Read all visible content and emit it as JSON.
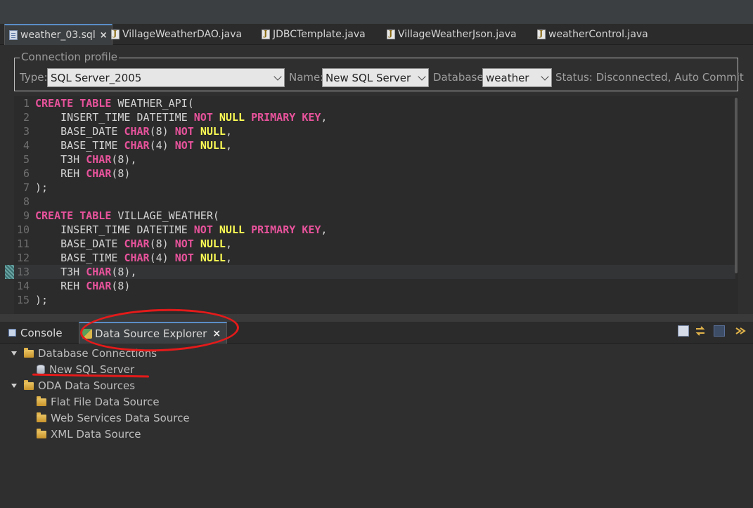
{
  "editor_tabs": [
    {
      "label": "weather_03.sql",
      "icon": "sql-file-icon",
      "active": true
    },
    {
      "label": "VillageWeatherDAO.java",
      "icon": "java-file-icon",
      "active": false
    },
    {
      "label": "JDBCTemplate.java",
      "icon": "java-file-icon",
      "active": false
    },
    {
      "label": "VillageWeatherJson.java",
      "icon": "java-file-icon",
      "active": false
    },
    {
      "label": "weatherControl.java",
      "icon": "java-file-icon",
      "active": false
    }
  ],
  "tab_close": "×",
  "connection": {
    "legend": "Connection profile",
    "type_label": "Type:",
    "type_value": "SQL Server_2005",
    "name_label": "Name:",
    "name_value": "New SQL Server",
    "database_label": "Database:",
    "database_value": "weather",
    "status": "Status: Disconnected, Auto Commit"
  },
  "code_lines": [
    {
      "n": "1",
      "text": "CREATE TABLE WEATHER_API("
    },
    {
      "n": "2",
      "text": "    INSERT_TIME DATETIME NOT NULL PRIMARY KEY,"
    },
    {
      "n": "3",
      "text": "    BASE_DATE CHAR(8) NOT NULL,"
    },
    {
      "n": "4",
      "text": "    BASE_TIME CHAR(4) NOT NULL,"
    },
    {
      "n": "5",
      "text": "    T3H CHAR(8),"
    },
    {
      "n": "6",
      "text": "    REH CHAR(8)"
    },
    {
      "n": "7",
      "text": ");"
    },
    {
      "n": "8",
      "text": ""
    },
    {
      "n": "9",
      "text": "CREATE TABLE VILLAGE_WEATHER("
    },
    {
      "n": "10",
      "text": "    INSERT_TIME DATETIME NOT NULL PRIMARY KEY,"
    },
    {
      "n": "11",
      "text": "    BASE_DATE CHAR(8) NOT NULL,"
    },
    {
      "n": "12",
      "text": "    BASE_TIME CHAR(4) NOT NULL,"
    },
    {
      "n": "13",
      "text": "    T3H CHAR(8),"
    },
    {
      "n": "14",
      "text": "    REH CHAR(8)"
    },
    {
      "n": "15",
      "text": ");"
    }
  ],
  "current_line": 13,
  "bottom_tabs": {
    "console": "Console",
    "dse": "Data Source Explorer"
  },
  "toolbar_icons": [
    "collapse-all-icon",
    "link-with-editor-icon",
    "tree-view-icon",
    "view-menu-icon"
  ],
  "tree": {
    "db_connections": "Database Connections",
    "new_sql_server": "New SQL Server",
    "oda_sources": "ODA Data Sources",
    "flat_file": "Flat File Data Source",
    "web_services": "Web Services Data Source",
    "xml": "XML Data Source"
  },
  "colors": {
    "keyword": "#e8539c",
    "null_keyword": "#ffff55",
    "annotation": "#e41a1a",
    "active_tab_accent": "#5a8ec7"
  }
}
